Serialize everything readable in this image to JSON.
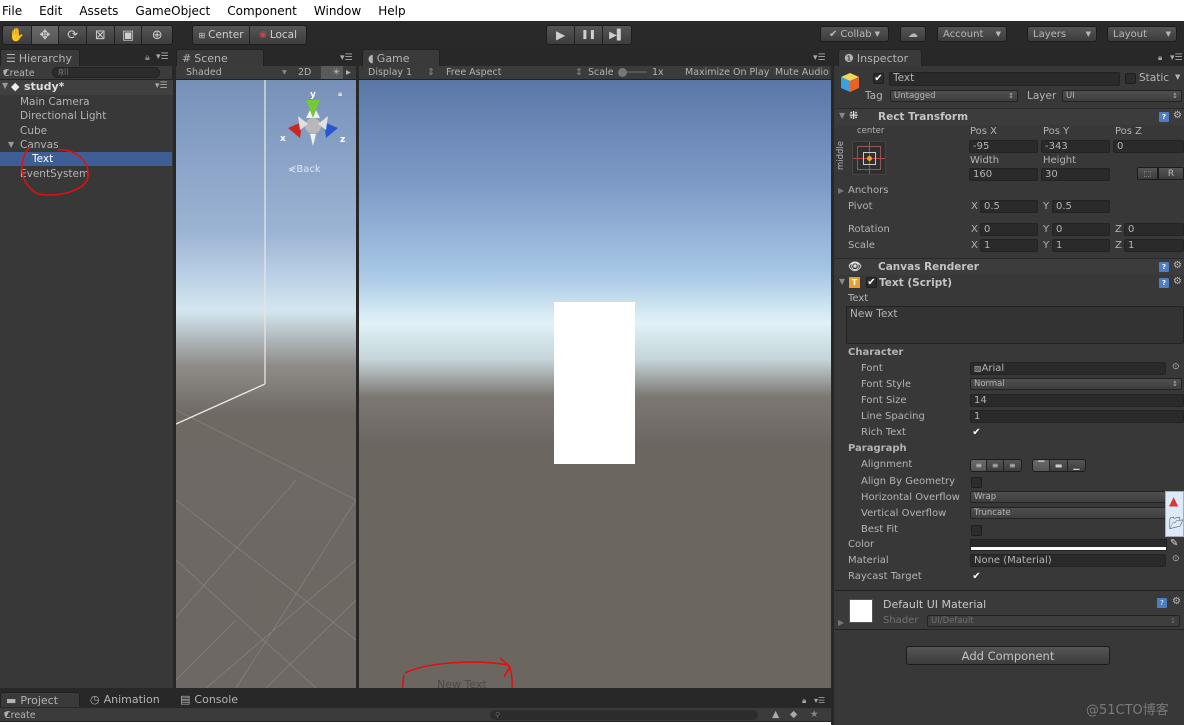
{
  "menu": [
    "File",
    "Edit",
    "Assets",
    "GameObject",
    "Component",
    "Window",
    "Help"
  ],
  "toolbar": {
    "tools": [
      "hand-tool",
      "move-tool",
      "rotate-tool",
      "scale-tool",
      "rect-tool",
      "transform-tool"
    ],
    "pivot": "Center",
    "space": "Local",
    "play": "▶",
    "pause": "❚❚",
    "step": "▶▌",
    "collab": "Collab",
    "account": "Account",
    "layers": "Layers",
    "layout": "Layout"
  },
  "hierarchy": {
    "tab": "Hierarchy",
    "create": "Create",
    "search_placeholder": "All",
    "scene": "study*",
    "items": [
      {
        "label": "Main Camera",
        "indent": 0
      },
      {
        "label": "Directional Light",
        "indent": 0
      },
      {
        "label": "Cube",
        "indent": 0
      },
      {
        "label": "Canvas",
        "indent": 0,
        "expanded": true
      },
      {
        "label": "Text",
        "indent": 1,
        "selected": true
      },
      {
        "label": "EventSystem",
        "indent": 0
      }
    ]
  },
  "scene": {
    "tab": "Scene",
    "shading": "Shaded",
    "mode2d": "2D",
    "back_label": "Back",
    "axes": {
      "x": "x",
      "y": "y",
      "z": "z"
    }
  },
  "game": {
    "tab": "Game",
    "display": "Display 1",
    "aspect": "Free Aspect",
    "scale_label": "Scale",
    "scale_value": "1x",
    "maximize": "Maximize On Play",
    "mute": "Mute Audio",
    "overlay_text": "New Text"
  },
  "bottom": {
    "tabs": [
      "Project",
      "Animation",
      "Console"
    ],
    "create": "Create"
  },
  "inspector": {
    "tab": "Inspector",
    "object_name": "Text",
    "static_label": "Static",
    "tag_label": "Tag",
    "tag": "Untagged",
    "layer_label": "Layer",
    "layer": "UI",
    "rect_transform": {
      "title": "Rect Transform",
      "anchor_h": "center",
      "anchor_v": "middle",
      "pos_x_label": "Pos X",
      "pos_x": "-95",
      "pos_y_label": "Pos Y",
      "pos_y": "-343",
      "pos_z_label": "Pos Z",
      "pos_z": "0",
      "width_label": "Width",
      "width": "160",
      "height_label": "Height",
      "height": "30",
      "r_button": "R",
      "anchors": "Anchors",
      "pivot_label": "Pivot",
      "pivot_x": "0.5",
      "pivot_y": "0.5",
      "rotation_label": "Rotation",
      "rot_x": "0",
      "rot_y": "0",
      "rot_z": "0",
      "scale_label": "Scale",
      "scale_x": "1",
      "scale_y": "1",
      "scale_z": "1",
      "x": "X",
      "y": "Y",
      "z": "Z"
    },
    "canvas_renderer": "Canvas Renderer",
    "text_script": {
      "title": "Text (Script)",
      "text_label": "Text",
      "text_value": "New Text",
      "character": "Character",
      "font_label": "Font",
      "font": "Arial",
      "font_style_label": "Font Style",
      "font_style": "Normal",
      "font_size_label": "Font Size",
      "font_size": "14",
      "line_spacing_label": "Line Spacing",
      "line_spacing": "1",
      "rich_text_label": "Rich Text",
      "rich_text": true,
      "paragraph": "Paragraph",
      "alignment_label": "Alignment",
      "align_geom_label": "Align By Geometry",
      "align_geom": false,
      "h_overflow_label": "Horizontal Overflow",
      "h_overflow": "Wrap",
      "v_overflow_label": "Vertical Overflow",
      "v_overflow": "Truncate",
      "best_fit_label": "Best Fit",
      "best_fit": false,
      "color_label": "Color",
      "color": "#ffffff",
      "material_label": "Material",
      "material": "None (Material)",
      "raycast_label": "Raycast Target",
      "raycast": true
    },
    "material": {
      "name": "Default UI Material",
      "shader_label": "Shader",
      "shader": "UI/Default"
    },
    "add_component": "Add Component"
  },
  "watermark": "@51CTO博客",
  "check": "✔"
}
